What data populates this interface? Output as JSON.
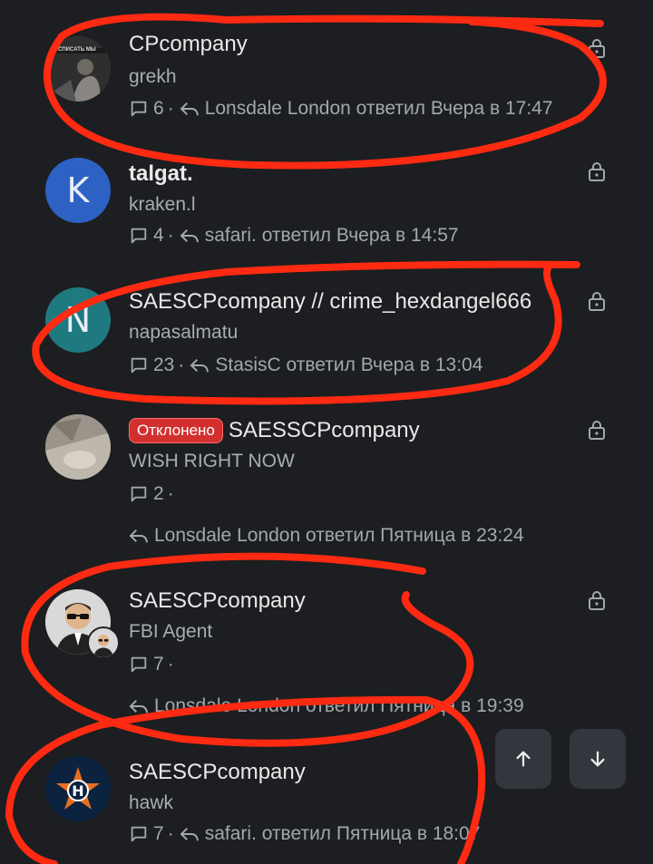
{
  "threads": [
    {
      "title": "CPcompany",
      "subtitle": "grekh",
      "replies": "6",
      "reply_text": "Lonsdale London ответил Вчера в 17:47",
      "avatar_caption": "СПИСАТЬ МЫ"
    },
    {
      "title": "talgat.",
      "subtitle": "kraken.l",
      "replies": "4",
      "reply_text": "safari. ответил Вчера в 14:57",
      "avatar_letter": "K"
    },
    {
      "title": "SAESCPcompany // crime_hexdangel666",
      "subtitle": "napasalmatu",
      "replies": "23",
      "reply_text": "StasisC ответил Вчера в 13:04",
      "avatar_letter": "N"
    },
    {
      "badge": "Отклонено",
      "title": "SAESSCPcompany",
      "subtitle": "WISH RIGHT NOW",
      "replies": "2",
      "reply_text": "Lonsdale London ответил Пятница в 23:24"
    },
    {
      "title": "SAESCPcompany",
      "subtitle": "FBI Agent",
      "replies": "7",
      "reply_text": "Lonsdale London ответил Пятница в 19:39"
    },
    {
      "title": "SAESCPcompany",
      "subtitle": "hawk",
      "replies": "7",
      "reply_text": "safari. ответил Пятница в 18:07"
    }
  ],
  "sep": "·",
  "colors": {
    "background": "#1c1e21",
    "annotation": "#ff2a12",
    "avatar_k": "#2d62c4",
    "avatar_n": "#1f7a80",
    "badge": "#d32f2f"
  },
  "icons": {
    "comment": "comment-icon",
    "reply": "reply-icon",
    "lock": "lock-icon",
    "up": "arrow-up-icon",
    "down": "arrow-down-icon"
  }
}
